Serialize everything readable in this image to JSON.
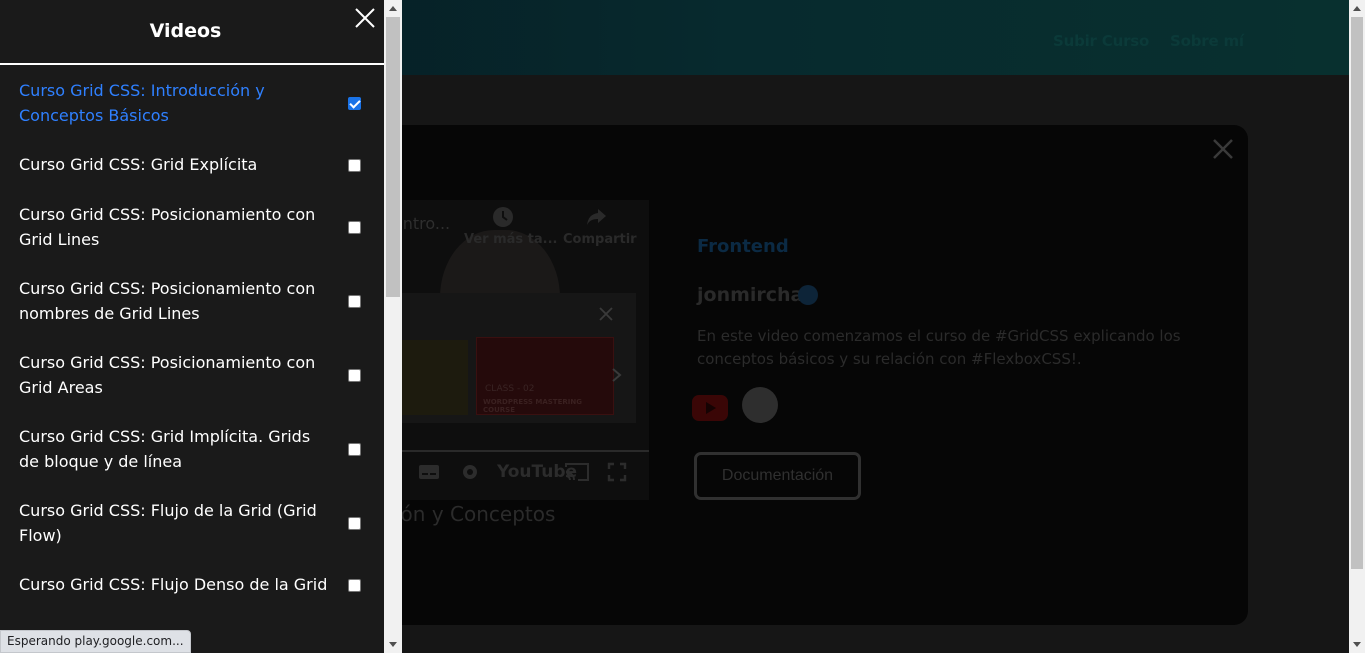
{
  "background_page": {
    "nav": [
      "Subir Curso",
      "Sobre mí"
    ],
    "video_player": {
      "partial_title": "Intro...",
      "watch_later_label": "Ver más ta...",
      "share_label": "Compartir",
      "youtube_label": "YouTube",
      "thumb_label": "CLASS - 02",
      "thumb_sublabel": "WORDPRESS MASTERING COURSE"
    },
    "video_title_fragment": "ción y Conceptos",
    "category": "Frontend",
    "author": "jonmircha",
    "description": "En este video comenzamos el curso de #GridCSS explicando los conceptos básicos y su relación con #FlexboxCSS!.",
    "documentation_button": "Documentación"
  },
  "sidebar": {
    "title": "Videos",
    "items": [
      {
        "label": "Curso Grid CSS: Introducción y Conceptos Básicos",
        "checked": true,
        "active": true
      },
      {
        "label": "Curso Grid CSS: Grid Explícita",
        "checked": false,
        "active": false
      },
      {
        "label": "Curso Grid CSS: Posicionamiento con Grid Lines",
        "checked": false,
        "active": false
      },
      {
        "label": "Curso Grid CSS: Posicionamiento con nombres de Grid Lines",
        "checked": false,
        "active": false
      },
      {
        "label": "Curso Grid CSS: Posicionamiento con Grid Areas",
        "checked": false,
        "active": false
      },
      {
        "label": "Curso Grid CSS: Grid Implícita. Grids de bloque y de línea",
        "checked": false,
        "active": false
      },
      {
        "label": "Curso Grid CSS: Flujo de la Grid (Grid Flow)",
        "checked": false,
        "active": false
      },
      {
        "label": "Curso Grid CSS: Flujo Denso de la Grid",
        "checked": false,
        "active": false
      }
    ]
  },
  "status_bar": "Esperando play.google.com..."
}
